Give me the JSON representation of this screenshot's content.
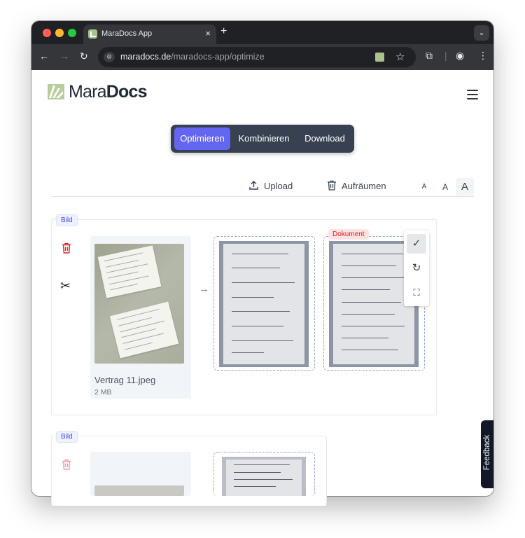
{
  "browser": {
    "tab_title": "MaraDocs App",
    "tab_close": "×",
    "new_tab": "+",
    "url_host": "maradocs.de",
    "url_path": "/maradocs-app/optimize"
  },
  "app": {
    "logo_prefix": "Mara",
    "logo_suffix": "Docs",
    "nav": {
      "optimize": "Optimieren",
      "combine": "Kombinieren",
      "download": "Download"
    },
    "actions": {
      "upload": "Upload",
      "cleanup": "Aufräumen",
      "font_small": "A",
      "font_medium": "A",
      "font_large": "A"
    },
    "items": [
      {
        "type_badge": "Bild",
        "file_name": "Vertrag 11.jpeg",
        "file_size": "2 MB",
        "result_badge": "Dokument"
      },
      {
        "type_badge": "Bild"
      }
    ],
    "feedback_label": "Feedback"
  },
  "colors": {
    "accent": "#6366f1",
    "danger": "#dc2626",
    "nav_bg": "#374151"
  }
}
